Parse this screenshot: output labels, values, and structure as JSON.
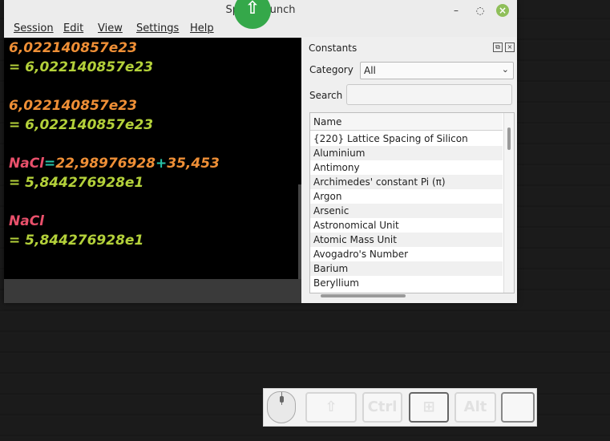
{
  "window": {
    "title": "SpeedCrunch",
    "min_icon": "minimize-icon",
    "max_icon": "maximize-icon",
    "close_icon": "close-icon"
  },
  "menu": [
    "Session",
    "Edit",
    "View",
    "Settings",
    "Help"
  ],
  "session": {
    "entries": [
      {
        "expression": [
          {
            "text": "6,022140857e23",
            "color": "orange"
          }
        ],
        "result": "6,022140857e23"
      },
      {
        "expression": [
          {
            "text": "6,022140857e23",
            "color": "orange"
          }
        ],
        "result": "6,022140857e23"
      },
      {
        "expression": [
          {
            "text": "NaCl",
            "color": "pink"
          },
          {
            "text": "=",
            "color": "teal"
          },
          {
            "text": "22,98976928",
            "color": "orange"
          },
          {
            "text": "+",
            "color": "teal"
          },
          {
            "text": "35,453",
            "color": "orange"
          }
        ],
        "result": "5,844276928e1"
      },
      {
        "expression": [
          {
            "text": "NaCl",
            "color": "pink"
          }
        ],
        "result": "5,844276928e1"
      }
    ],
    "result_prefix": "= "
  },
  "constants_panel": {
    "title": "Constants",
    "float_icon": "float-icon",
    "close_icon": "close-icon",
    "category_label": "Category",
    "category_value": "All",
    "search_label": "Search",
    "search_value": "",
    "column_header": "Name",
    "items": [
      "{220} Lattice Spacing of Silicon",
      "Aluminium",
      "Antimony",
      "Archimedes' constant Pi (π)",
      "Argon",
      "Arsenic",
      "Astronomical Unit",
      "Atomic Mass Unit",
      "Avogadro's Number",
      "Barium",
      "Beryllium"
    ]
  },
  "overlay": {
    "icon": "upload-arrow-icon",
    "glyph": "⇧"
  },
  "keybar": {
    "mouse_icon": "mouse-icon",
    "keys": [
      {
        "name": "shift",
        "label": "⇧"
      },
      {
        "name": "ctrl",
        "label": "Ctrl"
      },
      {
        "name": "super",
        "label": "⊞"
      },
      {
        "name": "alt",
        "label": "Alt"
      },
      {
        "name": "blank",
        "label": ""
      }
    ]
  },
  "colors": {
    "orange": "#ef8f36",
    "green": "#b4d13a",
    "teal": "#27c4a8",
    "pink": "#e9506b",
    "overlay_green": "#35a84a"
  }
}
